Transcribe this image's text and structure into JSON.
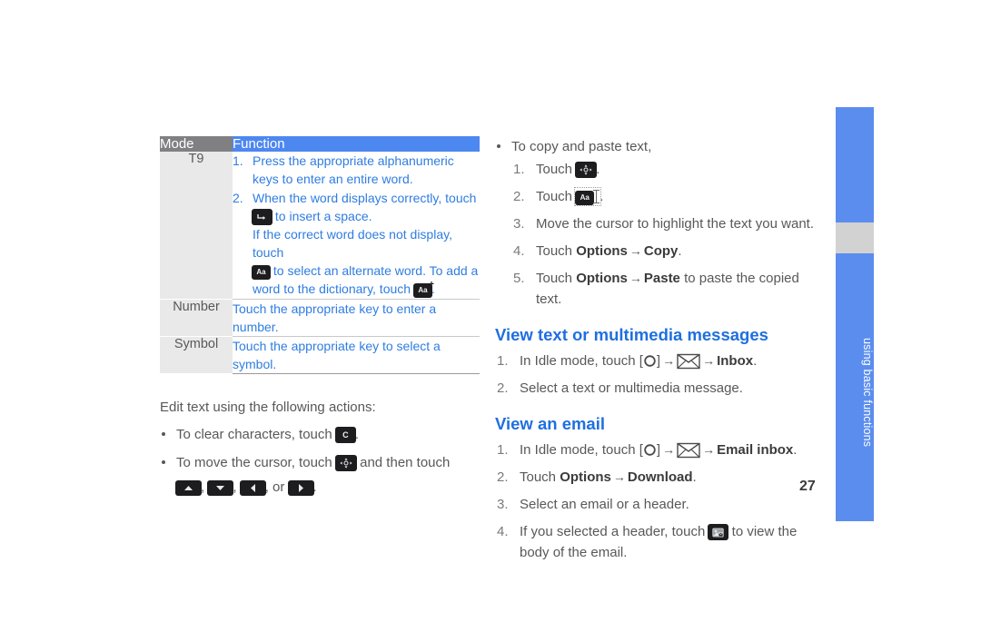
{
  "document": {
    "page_number": "27",
    "side_tab_label": "using basic functions",
    "accent_blue": "#2f7de1",
    "heading_blue": "#1f6fe0",
    "tab_blue": "#5b8def",
    "header_gray": "#808083"
  },
  "table": {
    "headers": {
      "mode": "Mode",
      "function": "Function"
    },
    "rows": [
      {
        "mode": "T9",
        "steps": [
          {
            "num": "1.",
            "text": "Press the appropriate alphanumeric keys to enter an entire word."
          },
          {
            "num": "2.",
            "text_before_icon": "When the word displays correctly, touch",
            "icon": "space-key-icon",
            "text_after_icon": "to insert a space.",
            "extra_line_1_before": "If the correct word does not display, touch",
            "extra_icon_1": "aa-key-icon",
            "extra_line_1_after": "to select an alternate word. To add a",
            "extra_line_2_before": "word to the dictionary, touch",
            "extra_icon_2": "aa-plus-key-icon",
            "extra_line_2_after": "."
          }
        ]
      },
      {
        "mode": "Number",
        "text": "Touch the appropriate key to enter a number."
      },
      {
        "mode": "Symbol",
        "text": "Touch the appropriate key to select a symbol."
      }
    ]
  },
  "left_section": {
    "lead": "Edit text using the following actions:",
    "bullets": [
      {
        "before": "To clear characters, touch",
        "icon": "clear-key-icon",
        "after": "."
      },
      {
        "before": "To move the cursor, touch",
        "icon": "navigate-key-icon",
        "middle": "and then touch",
        "icons": [
          "up-arrow-key-icon",
          "down-arrow-key-icon",
          "left-arrow-key-icon",
          "right-arrow-key-icon"
        ],
        "separator_1": ",",
        "separator_2": ",",
        "separator_3": ", or",
        "after": "."
      }
    ]
  },
  "right_section": {
    "copy_paste": {
      "bullet": "To copy and paste text,",
      "steps": [
        {
          "num": "1.",
          "before": "Touch",
          "icon": "navigate-key-icon",
          "after": "."
        },
        {
          "num": "2.",
          "before": "Touch",
          "icon": "aa-cursor-key-icon",
          "after": "."
        },
        {
          "num": "3.",
          "text": "Move the cursor to highlight the text you want."
        },
        {
          "num": "4.",
          "before": "Touch",
          "bold_1": "Options",
          "arrow": "→",
          "bold_2": "Copy",
          "after": "."
        },
        {
          "num": "5.",
          "before": "Touch",
          "bold_1": "Options",
          "arrow": "→",
          "bold_2": "Paste",
          "after": " to paste the copied text."
        }
      ]
    },
    "view_messages": {
      "heading": "View text or multimedia messages",
      "steps": [
        {
          "num": "1.",
          "before": "In Idle mode, touch [",
          "key": "O",
          "mid": "]",
          "arrow1": "→",
          "icon": "envelope-icon",
          "arrow2": "→",
          "bold": "Inbox",
          "after": "."
        },
        {
          "num": "2.",
          "text": "Select a text or multimedia message."
        }
      ]
    },
    "view_email": {
      "heading": "View an email",
      "steps": [
        {
          "num": "1.",
          "before": "In Idle mode, touch [",
          "key": "O",
          "mid": "]",
          "arrow1": "→",
          "icon": "envelope-icon",
          "arrow2": "→",
          "bold": "Email inbox",
          "after": "."
        },
        {
          "num": "2.",
          "before": "Touch",
          "bold_1": "Options",
          "arrow": "→",
          "bold_2": "Download",
          "after": "."
        },
        {
          "num": "3.",
          "text": "Select an email or a header."
        },
        {
          "num": "4.",
          "before": "If you selected a header, touch",
          "icon": "email-body-key-icon",
          "after": "to view the body of the email."
        }
      ]
    }
  }
}
